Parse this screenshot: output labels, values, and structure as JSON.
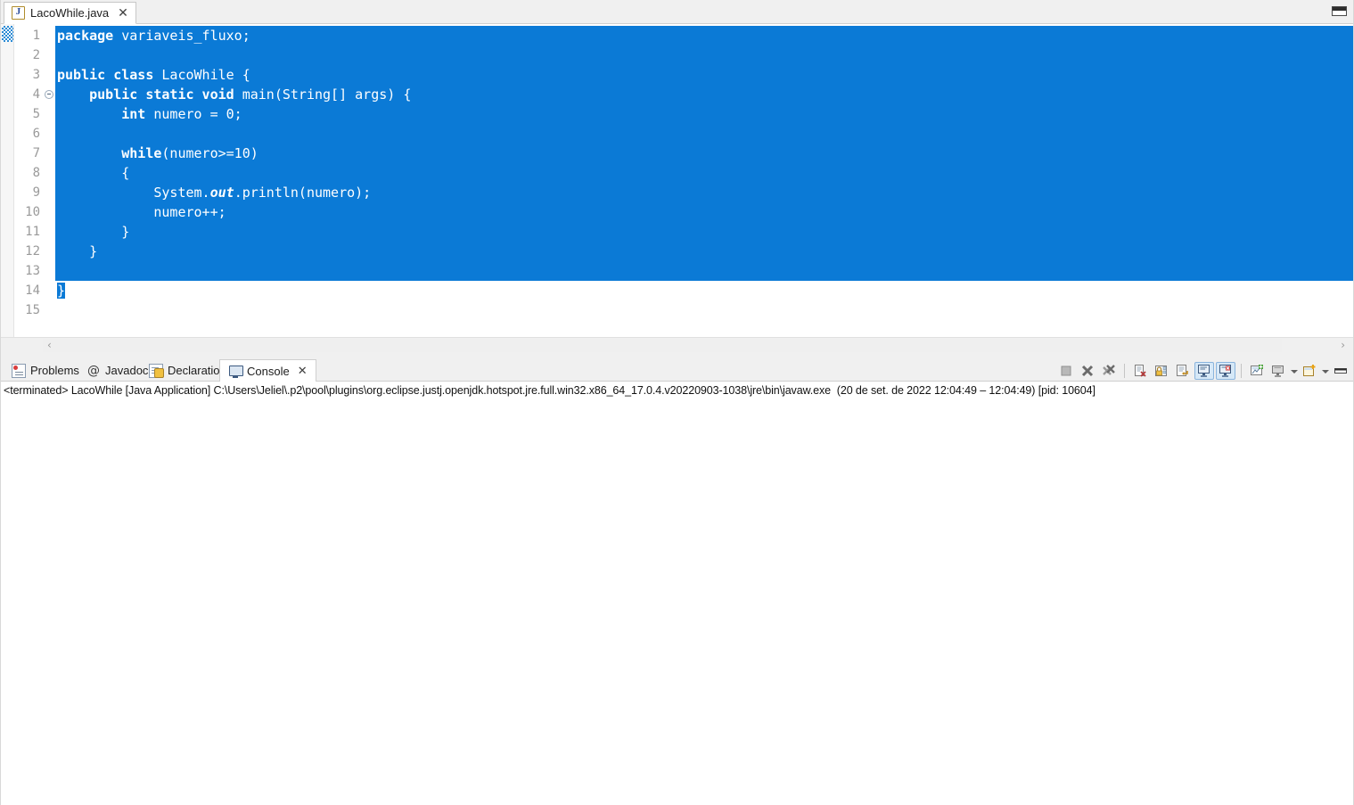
{
  "window": {
    "minimize_label": "Minimize"
  },
  "editor": {
    "tab": {
      "title": "LacoWhile.java",
      "close": "✕",
      "icon": "java-file-icon"
    },
    "line_numbers": [
      "1",
      "2",
      "3",
      "4",
      "5",
      "6",
      "7",
      "8",
      "9",
      "10",
      "11",
      "12",
      "13",
      "14",
      "15"
    ],
    "fold_marker_line": "4",
    "selection_color": "#0b7ad6",
    "code_lines": [
      {
        "n": 1,
        "selected": true,
        "segments": [
          {
            "t": "package",
            "b": true
          },
          {
            "t": " variaveis_fluxo;",
            "b": false
          }
        ]
      },
      {
        "n": 2,
        "selected": true,
        "segments": [
          {
            "t": "",
            "b": false
          }
        ]
      },
      {
        "n": 3,
        "selected": true,
        "segments": [
          {
            "t": "public class",
            "b": true
          },
          {
            "t": " LacoWhile {",
            "b": false
          }
        ]
      },
      {
        "n": 4,
        "selected": true,
        "segments": [
          {
            "t": "    ",
            "b": false
          },
          {
            "t": "public static void",
            "b": true
          },
          {
            "t": " main(String[] args) {",
            "b": false
          }
        ]
      },
      {
        "n": 5,
        "selected": true,
        "segments": [
          {
            "t": "        ",
            "b": false
          },
          {
            "t": "int",
            "b": true
          },
          {
            "t": " numero = 0;",
            "b": false
          }
        ]
      },
      {
        "n": 6,
        "selected": true,
        "segments": [
          {
            "t": "",
            "b": false
          }
        ]
      },
      {
        "n": 7,
        "selected": true,
        "segments": [
          {
            "t": "        ",
            "b": false
          },
          {
            "t": "while",
            "b": true
          },
          {
            "t": "(numero>=10)",
            "b": false
          }
        ]
      },
      {
        "n": 8,
        "selected": true,
        "segments": [
          {
            "t": "        {",
            "b": false
          }
        ]
      },
      {
        "n": 9,
        "selected": true,
        "segments": [
          {
            "t": "            System.",
            "b": false
          },
          {
            "t": "out",
            "b": false,
            "i": true
          },
          {
            "t": ".println(numero);",
            "b": false
          }
        ]
      },
      {
        "n": 10,
        "selected": true,
        "segments": [
          {
            "t": "            numero++;",
            "b": false
          }
        ]
      },
      {
        "n": 11,
        "selected": true,
        "segments": [
          {
            "t": "        }",
            "b": false
          }
        ]
      },
      {
        "n": 12,
        "selected": true,
        "segments": [
          {
            "t": "    }",
            "b": false
          }
        ]
      },
      {
        "n": 13,
        "selected": true,
        "segments": [
          {
            "t": "",
            "b": false
          }
        ]
      },
      {
        "n": 14,
        "selected": "partial",
        "segments": [
          {
            "t": "}",
            "b": false
          }
        ]
      },
      {
        "n": 15,
        "selected": false,
        "segments": [
          {
            "t": "",
            "b": false
          }
        ]
      }
    ],
    "hscroll": {
      "left_arrow": "‹",
      "right_arrow": "›"
    }
  },
  "console_panel": {
    "tabs": [
      {
        "label": "Problems",
        "icon": "problems-icon",
        "active": false,
        "closable": false
      },
      {
        "label": "Javadoc",
        "icon": "at-icon",
        "active": false,
        "closable": false
      },
      {
        "label": "Declaration",
        "icon": "declaration-icon",
        "active": false,
        "closable": false
      },
      {
        "label": "Console",
        "icon": "console-icon",
        "active": true,
        "closable": true,
        "close": "✕"
      }
    ],
    "toolbar": [
      {
        "name": "terminate-button",
        "state": "disabled"
      },
      {
        "name": "remove-launch-button",
        "state": "normal"
      },
      {
        "name": "remove-all-terminated-button",
        "state": "normal"
      },
      {
        "name": "clear-console-button",
        "state": "normal"
      },
      {
        "name": "scroll-lock-button",
        "state": "normal"
      },
      {
        "name": "word-wrap-button",
        "state": "normal"
      },
      {
        "name": "show-console-on-output-button",
        "state": "active"
      },
      {
        "name": "show-console-on-error-button",
        "state": "active"
      },
      {
        "name": "pin-console-button",
        "state": "normal"
      },
      {
        "name": "display-selected-console-button",
        "state": "normal"
      },
      {
        "name": "open-console-button",
        "state": "normal"
      },
      {
        "name": "view-menu-button",
        "state": "normal"
      },
      {
        "name": "minimize-view-button",
        "state": "normal"
      }
    ],
    "output": "<terminated> LacoWhile [Java Application] C:\\Users\\Jeliel\\.p2\\pool\\plugins\\org.eclipse.justj.openjdk.hotspot.jre.full.win32.x86_64_17.0.4.v20220903-1038\\jre\\bin\\javaw.exe  (20 de set. de 2022 12:04:49 – 12:04:49) [pid: 10604]"
  }
}
